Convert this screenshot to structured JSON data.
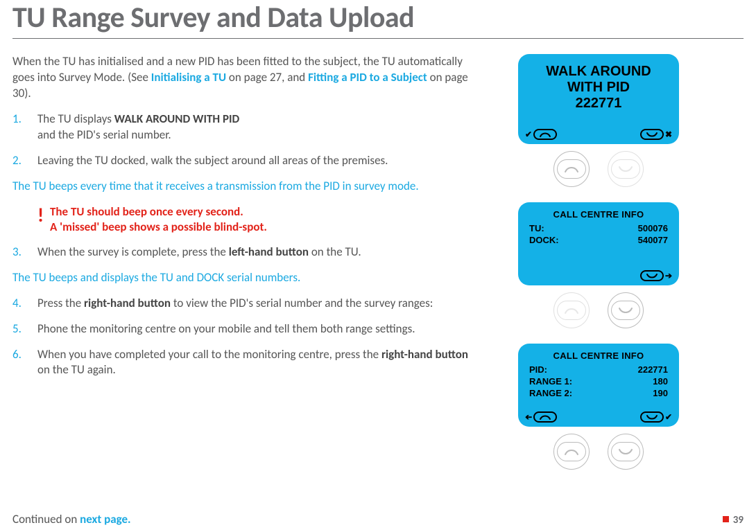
{
  "header": {
    "title": "TU Range Survey and Data Upload"
  },
  "intro": {
    "text_a": "When the TU has initialised and a new PID has been fitted to the subject, the TU automatically goes into Survey Mode. (See ",
    "ref1": "Initialising a TU",
    "text_b": " on page 27, and ",
    "ref2": "Fitting a PID to a Subject",
    "text_c": " on page 30)."
  },
  "steps": {
    "s1a": "The TU displays ",
    "s1b": "WALK AROUND WITH PID",
    "s1c": " and the PID's serial number.",
    "s2": "Leaving the TU docked, walk the subject around all areas of the premises.",
    "note2": "The TU beeps every time that it receives a transmission from the PID in survey mode.",
    "warn_l1": "The TU should beep once every second.",
    "warn_l2": "A 'missed' beep shows a possible blind-spot.",
    "s3a": "When the survey is complete, press the ",
    "s3b": "left-hand button",
    "s3c": " on the TU.",
    "note3": "The TU beeps and displays the TU and DOCK serial numbers.",
    "s4a": "Press the ",
    "s4b": "right-hand button",
    "s4c": " to view the PID's serial number and the survey ranges:",
    "s5": "Phone the monitoring centre on your mobile and tell them both range settings.",
    "s6a": "When you have completed your call to the monitoring centre, press the ",
    "s6b": "right-hand button",
    "s6c": " on the TU again."
  },
  "continued": {
    "text": "Continued on ",
    "link": "next page."
  },
  "page_number": "39",
  "devices": {
    "d1": {
      "line1": "WALK AROUND",
      "line2": "WITH PID",
      "line3": "222771"
    },
    "d2": {
      "heading": "CALL CENTRE INFO",
      "k1": "TU:",
      "v1": "500076",
      "k2": "DOCK:",
      "v2": "540077"
    },
    "d3": {
      "heading": "CALL CENTRE INFO",
      "k1": "PID:",
      "v1": "222771",
      "k2": "RANGE 1:",
      "v2": "180",
      "k3": "RANGE 2:",
      "v3": "190"
    }
  }
}
